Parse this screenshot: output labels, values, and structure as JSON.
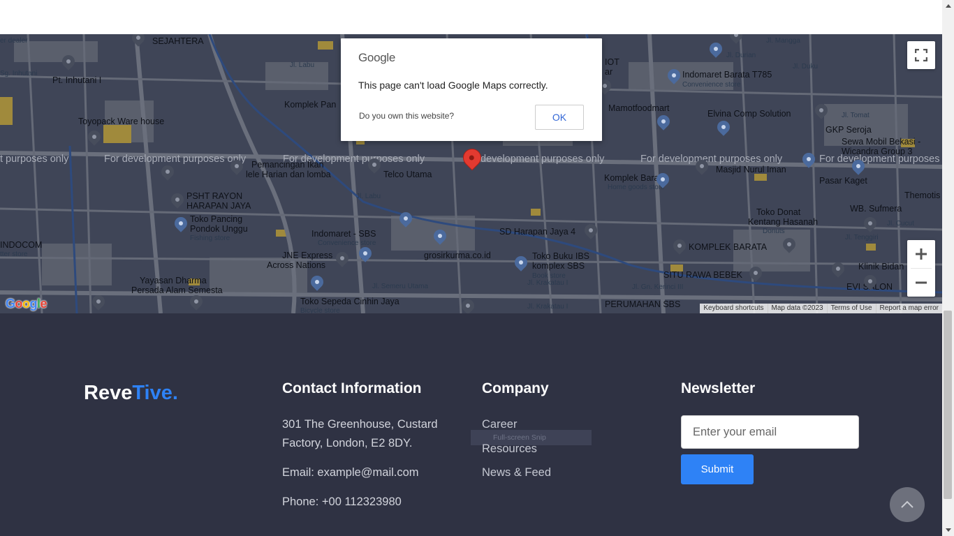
{
  "map": {
    "watermark": "For development purposes only",
    "watermark_partial_left": "t purposes only",
    "watermark_partial_right": "For development purposes",
    "watermark_partial_mid": "development purposes only",
    "labels": {
      "sejahtera": "SEJAHTERA",
      "inhutani": "Pt. Inhutani I",
      "toyopack": "Toyopack Ware house",
      "dealer": "er dealer",
      "inhutani_small": "Sg. Inhutani",
      "jl_labu": "Jl. Labu",
      "komplek_pan": "Komplek Pan",
      "pemancingan": "Pemancingan Ikan",
      "lele": "lele Harian dan lomba",
      "telco": "Telco Utama",
      "psht1": "PSHT RAYON",
      "psht2": "HARAPAN JAYA",
      "pancing1": "Toko Pancing",
      "pancing2": "Pondok Unggu",
      "fishing": "Fishing store",
      "indocom": "INDOCOM",
      "tter_store": "tter store",
      "indomaret_sbs": "Indomaret - SBS",
      "convenience": "Convenience store",
      "jne1": "JNE Express",
      "jne2": "Across Nations",
      "grosir": "grosirkurma.co.id",
      "sd_harapan": "SD Harapan Jaya 4",
      "toko_bulk1": "Toko Buku IBS",
      "toko_bulk2": "komplex SBS",
      "book_store": "Book store",
      "yayasan1": "Yayasan Dharma",
      "yayasan2": "Persada Alam Semesta",
      "jl_semeru": "Jl. Semeru Utama",
      "sepeda": "Toko Sepeda Cinhin Jaya",
      "bicycle": "Bicycle store",
      "krakatau": "Jl. Krakatau I",
      "krakatau2": "Jl. Krakatau I",
      "perumahan": "PERUMAHAN SBS",
      "jl_durian": "Jl. Durian",
      "mangga": "Jl. Mangga",
      "jl_duku": "Jl. Duku",
      "indomaret_barata": "Indomaret Barata T785",
      "convenience2": "Convenience store",
      "mamoto": "Mamotfoodmart",
      "elvina": "Elvina Comp Solution",
      "tomat": "Jl. Tomat",
      "gkp": "GKP Seroja",
      "sewa1": "Sewa Mobil Bekasi -",
      "sewa2": "Wicandra Group 3",
      "komplek_barata": "Komplek Barata",
      "home_goods": "Home goods store",
      "masjid": "Masjid Nurul Iman",
      "pasar": "Pasar Kaget",
      "themotis": "Themotis",
      "sufmera": "WB. Sufmera",
      "donat1": "Toko Donat",
      "donat2": "Kentang Hasanah",
      "donuts": "Donuts",
      "cucut": "Jl. Cucut",
      "komplek_barata2": "KOMPLEK BARATA",
      "rawa": "SITU RAWA BEBEK",
      "klinik": "Klinik Bidan",
      "evi": "EVI SALON",
      "tenggiri": "Jl. Tenggiri",
      "kerinci": "Jl. Gn. Kerinci III",
      "iot": "IOT",
      "ar": "ar"
    },
    "attribution": [
      "Keyboard shortcuts",
      "Map data ©2023",
      "Terms of Use",
      "Report a map error"
    ],
    "google_logo": "Google"
  },
  "dialog": {
    "brand": "Google",
    "message": "This page can't load Google Maps correctly.",
    "own_link": "Do you own this website?",
    "ok_label": "OK"
  },
  "footer": {
    "brand_part1": "Reve",
    "brand_part2": "Tive.",
    "contact": {
      "title": "Contact Information",
      "address_line1": "301 The Greenhouse, Custard",
      "address_line2": "Factory, London, E2 8DY.",
      "email": "Email: example@mail.com",
      "phone": "Phone: +00 112323980"
    },
    "company": {
      "title": "Company",
      "links": [
        "Career",
        "Resources",
        "News & Feed"
      ]
    },
    "newsletter": {
      "title": "Newsletter",
      "placeholder": "Enter your email",
      "submit_label": "Submit"
    },
    "snip_overlay": "Full-screen Snip"
  },
  "colors": {
    "accent": "#2e82f6",
    "footer_bg": "#2f3243",
    "map_bg": "#3f4557"
  }
}
